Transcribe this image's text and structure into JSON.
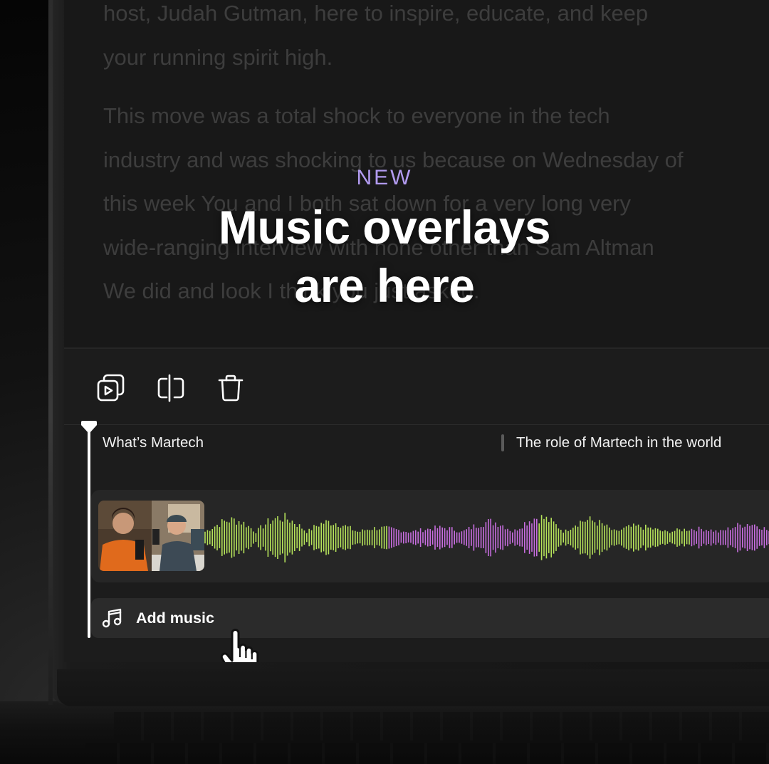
{
  "transcript": {
    "paragraphs": [
      [
        "host, Judah Gutman, here to inspire, educate, and keep",
        "your running spirit high."
      ],
      [
        "This move was a total shock to everyone in the tech",
        "industry and was shocking to us because on Wednesday of",
        "this week You and I both sat down for a very long very",
        "wide-ranging interview with none other than Sam Altman",
        "We did and look I think you just asked."
      ]
    ]
  },
  "announcement": {
    "badge": "NEW",
    "title_line1": "Music overlays",
    "title_line2": "are here"
  },
  "toolbar": {
    "icons": [
      "replace-media-icon",
      "split-icon",
      "trash-icon"
    ]
  },
  "chapters": [
    {
      "title": "What’s Martech"
    },
    {
      "title": "The role of Martech in the world"
    }
  ],
  "music_track": {
    "label": "Add music",
    "icon": "music-note-icon"
  },
  "colors": {
    "accent_new": "#b29bf0",
    "wave_green": "#b6e35a",
    "wave_purple": "#c86ee0",
    "screen_bg": "#181818",
    "editor_bg": "#1c1c1c"
  }
}
